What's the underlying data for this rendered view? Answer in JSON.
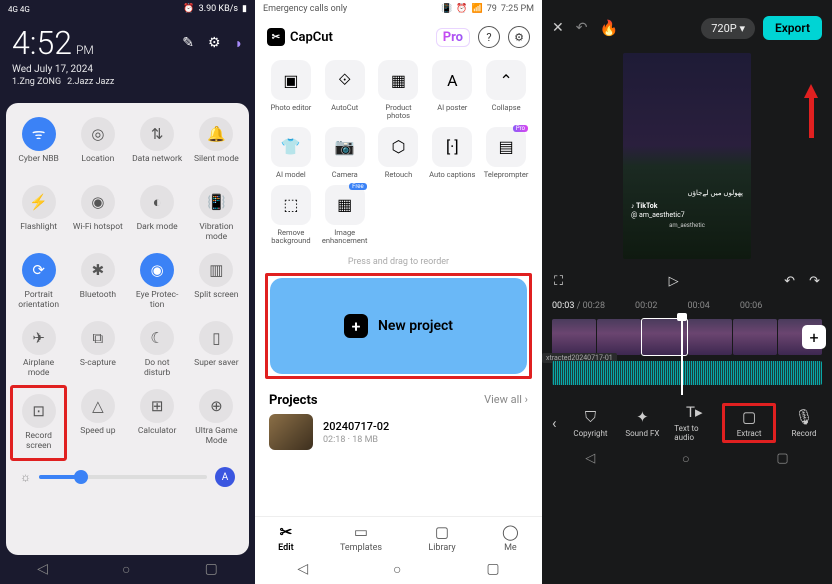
{
  "phone1": {
    "statusbar": {
      "signal": "4G 4G",
      "data_rate": "3.90 KB/s",
      "battery": "62"
    },
    "clock": {
      "time": "4:52",
      "ampm": "PM",
      "date": "Wed July 17, 2024"
    },
    "sim": {
      "sim1_idx": "1.",
      "sim1": "Zng ZONG",
      "sim2_idx": "2.",
      "sim2": "Jazz Jazz"
    },
    "quick_settings": [
      {
        "label": "Cyber NBB",
        "icon": "wifi",
        "active": true
      },
      {
        "label": "Location",
        "icon": "pin"
      },
      {
        "label": "Data network",
        "icon": "swap"
      },
      {
        "label": "Silent mode",
        "icon": "bell"
      },
      {
        "label": "Flashlight",
        "icon": "flash"
      },
      {
        "label": "Wi-Fi hotspot",
        "icon": "hotspot"
      },
      {
        "label": "Dark mode",
        "icon": "moon"
      },
      {
        "label": "Vibration mode",
        "icon": "vibrate"
      },
      {
        "label": "Portrait orientation",
        "icon": "rotate",
        "active": true
      },
      {
        "label": "Bluetooth",
        "icon": "bt"
      },
      {
        "label": "Eye Protec-\ntion",
        "icon": "eye",
        "active": true
      },
      {
        "label": "Split screen",
        "icon": "split"
      },
      {
        "label": "Airplane mode",
        "icon": "plane"
      },
      {
        "label": "S-capture",
        "icon": "capture"
      },
      {
        "label": "Do not disturb",
        "icon": "dnd"
      },
      {
        "label": "Super saver",
        "icon": "battery"
      },
      {
        "label": "Record screen",
        "icon": "record",
        "highlight": true
      },
      {
        "label": "Speed up",
        "icon": "rocket"
      },
      {
        "label": "Calculator",
        "icon": "calc"
      },
      {
        "label": "Ultra Game Mode",
        "icon": "game"
      }
    ],
    "brightness": {
      "sun_icon": "☼",
      "percent": 25,
      "auto": "A"
    }
  },
  "phone2": {
    "statusbar": {
      "left": "Emergency calls only",
      "battery": "79",
      "time": "7:25 PM"
    },
    "app_name": "CapCut",
    "pro": "Pro",
    "tools": [
      {
        "label": "Photo editor"
      },
      {
        "label": "AutoCut"
      },
      {
        "label": "Product photos"
      },
      {
        "label": "AI poster"
      },
      {
        "label": "Collapse",
        "isCollapse": true
      },
      {
        "label": "AI model"
      },
      {
        "label": "Camera"
      },
      {
        "label": "Retouch"
      },
      {
        "label": "Auto captions"
      },
      {
        "label": "Teleprompter",
        "tag": "Pro"
      },
      {
        "label": "Remove background"
      },
      {
        "label": "Image enhancement",
        "tag": "Free"
      }
    ],
    "drag_hint": "Press and drag to reorder",
    "new_project": "New project",
    "projects_title": "Projects",
    "view_all": "View all",
    "project1": {
      "name": "20240717-02",
      "meta": "02:18 · 18 MB"
    },
    "tabs": [
      {
        "label": "Edit",
        "active": true
      },
      {
        "label": "Templates"
      },
      {
        "label": "Library"
      },
      {
        "label": "Me"
      }
    ]
  },
  "phone3": {
    "resolution": "720P",
    "export": "Export",
    "tiktok": {
      "logo": "TikTok",
      "handle": "@ am_aesthetic7"
    },
    "caption": "پھولوں میں لےجاؤں",
    "credit": "am_aesthetic",
    "time": {
      "cur": "00:03",
      "total": "00:28",
      "t1": "00:02",
      "t2": "00:04",
      "t3": "00:06"
    },
    "extracted": "xtracted20240717-01",
    "tools": [
      {
        "label": "Copyright",
        "icon": "shield"
      },
      {
        "label": "Sound FX",
        "icon": "sparkle"
      },
      {
        "label": "Text to audio",
        "icon": "text"
      },
      {
        "label": "Extract",
        "icon": "folder",
        "highlight": true
      },
      {
        "label": "Record",
        "icon": "mic"
      }
    ]
  }
}
